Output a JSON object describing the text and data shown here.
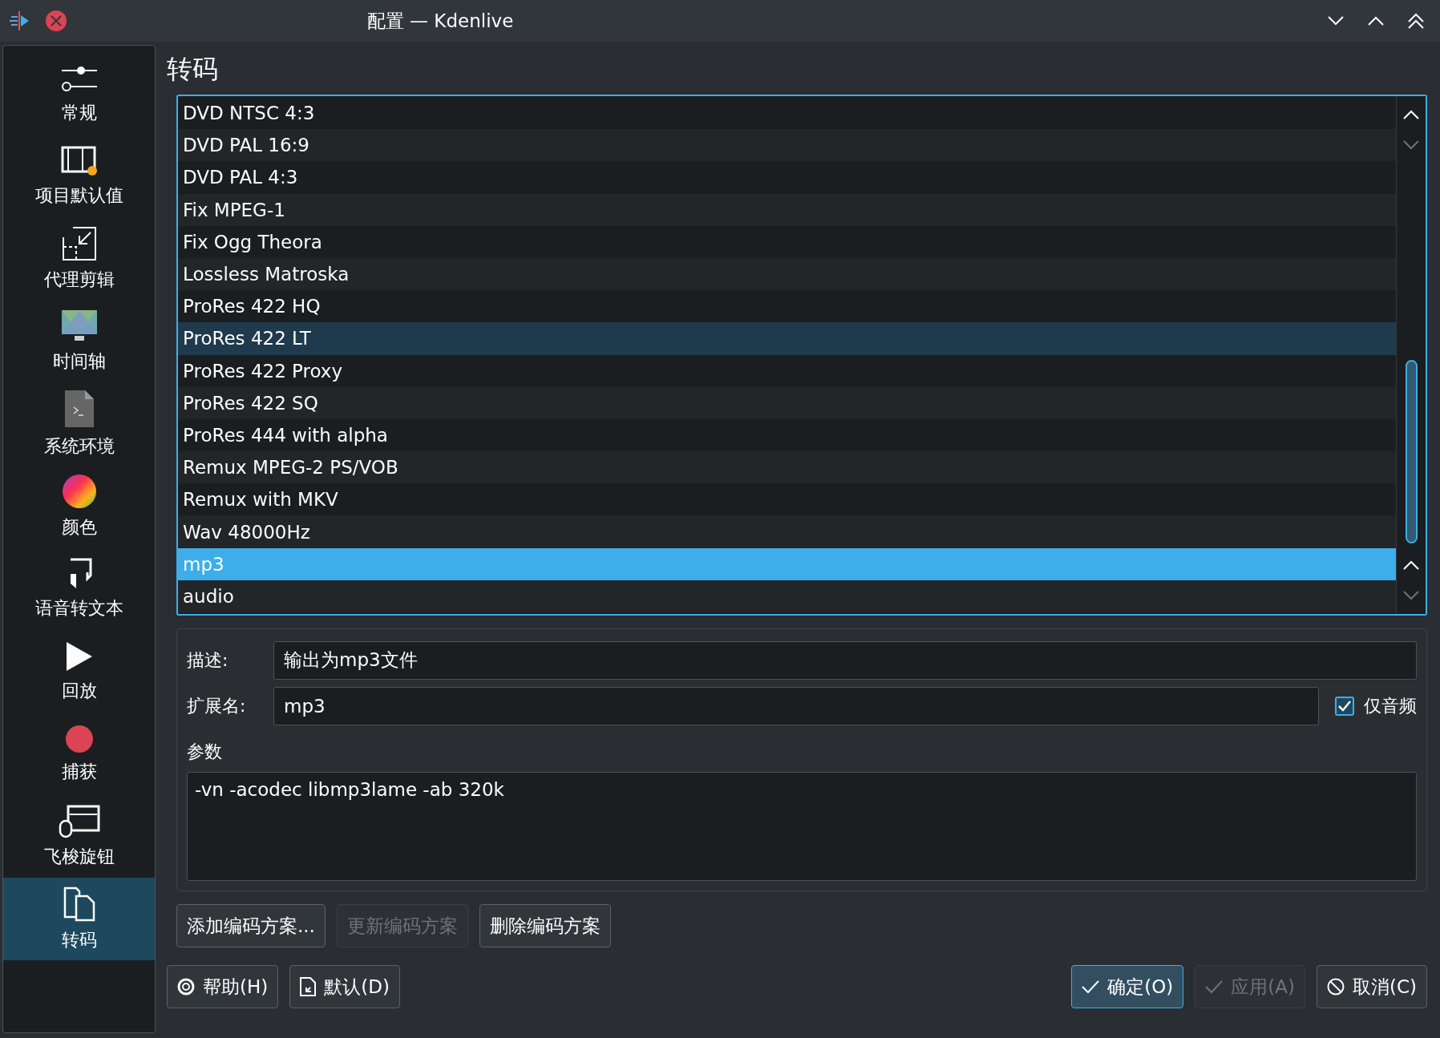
{
  "window": {
    "title": "配置 — Kdenlive"
  },
  "sidebar": {
    "items": [
      {
        "label": "常规",
        "selected": false
      },
      {
        "label": "项目默认值",
        "selected": false
      },
      {
        "label": "代理剪辑",
        "selected": false
      },
      {
        "label": "时间轴",
        "selected": false
      },
      {
        "label": "系统环境",
        "selected": false
      },
      {
        "label": "颜色",
        "selected": false
      },
      {
        "label": "语音转文本",
        "selected": false
      },
      {
        "label": "回放",
        "selected": false
      },
      {
        "label": "捕获",
        "selected": false
      },
      {
        "label": "飞梭旋钮",
        "selected": false
      },
      {
        "label": "转码",
        "selected": true
      }
    ]
  },
  "page": {
    "heading": "转码"
  },
  "profiles": [
    {
      "label": "DVD NTSC 4:3",
      "selected": false,
      "hovered": false
    },
    {
      "label": "DVD PAL 16:9",
      "selected": false,
      "hovered": false
    },
    {
      "label": "DVD PAL 4:3",
      "selected": false,
      "hovered": false
    },
    {
      "label": "Fix MPEG-1",
      "selected": false,
      "hovered": false
    },
    {
      "label": "Fix Ogg Theora",
      "selected": false,
      "hovered": false
    },
    {
      "label": "Lossless Matroska",
      "selected": false,
      "hovered": false
    },
    {
      "label": "ProRes 422 HQ",
      "selected": false,
      "hovered": false
    },
    {
      "label": "ProRes 422 LT",
      "selected": false,
      "hovered": true
    },
    {
      "label": "ProRes 422 Proxy",
      "selected": false,
      "hovered": false
    },
    {
      "label": "ProRes 422 SQ",
      "selected": false,
      "hovered": false
    },
    {
      "label": "ProRes 444 with alpha",
      "selected": false,
      "hovered": false
    },
    {
      "label": "Remux MPEG-2 PS/VOB",
      "selected": false,
      "hovered": false
    },
    {
      "label": "Remux with MKV",
      "selected": false,
      "hovered": false
    },
    {
      "label": "Wav 48000Hz",
      "selected": false,
      "hovered": false
    },
    {
      "label": "mp3",
      "selected": true,
      "hovered": false
    },
    {
      "label": "audio",
      "selected": false,
      "hovered": false
    }
  ],
  "form": {
    "description_label": "描述:",
    "description_value": "输出为mp3文件",
    "extension_label": "扩展名:",
    "extension_value": "mp3",
    "audio_only": {
      "label": "仅音频",
      "checked": true
    },
    "params_label": "参数",
    "params_value": "-vn -acodec libmp3lame -ab 320k"
  },
  "profile_buttons": [
    {
      "label": "添加编码方案...",
      "disabled": false
    },
    {
      "label": "更新编码方案",
      "disabled": true
    },
    {
      "label": "删除编码方案",
      "disabled": false
    }
  ],
  "dialog_buttons_left": [
    {
      "label": "帮助(H)",
      "disabled": false,
      "default": false
    },
    {
      "label": "默认(D)",
      "disabled": false,
      "default": false
    }
  ],
  "dialog_buttons_right": [
    {
      "label": "确定(O)",
      "disabled": false,
      "default": true
    },
    {
      "label": "应用(A)",
      "disabled": true,
      "default": false
    },
    {
      "label": "取消(C)",
      "disabled": false,
      "default": false
    }
  ]
}
